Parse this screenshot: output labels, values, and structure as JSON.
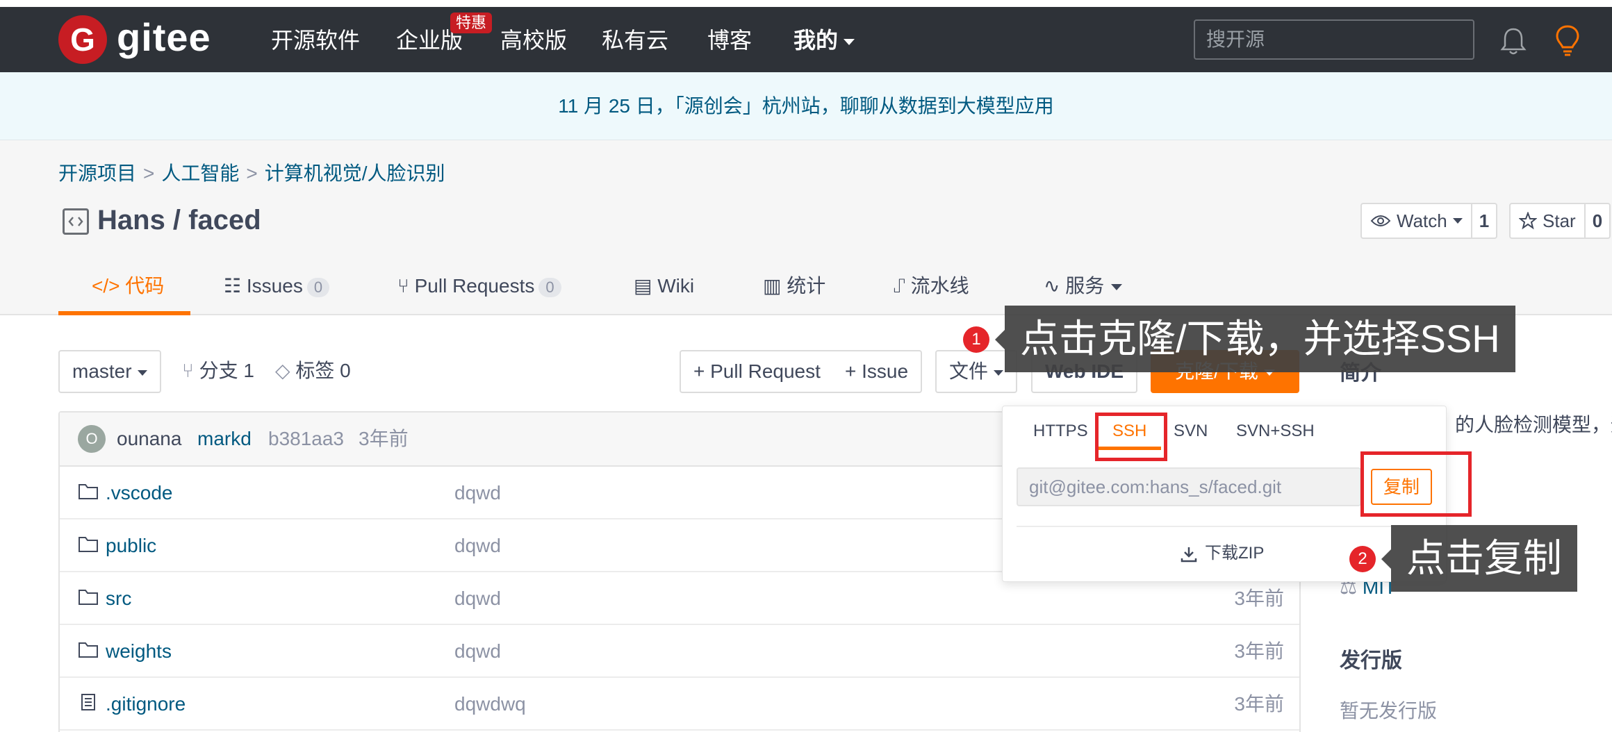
{
  "nav": {
    "logo_letter": "G",
    "logo_text": "gitee",
    "items": [
      "开源软件",
      "企业版",
      "高校版",
      "私有云",
      "博客",
      "我的"
    ],
    "badge": "特惠",
    "search_placeholder": "搜开源"
  },
  "announcement": "11 月 25 日，「源创会」杭州站，聊聊从数据到大模型应用",
  "breadcrumb": [
    "开源项目",
    "人工智能",
    "计算机视觉/人脸识别"
  ],
  "repo": {
    "title": "Hans / faced",
    "watch_label": "Watch",
    "watch_count": "1",
    "star_label": "Star",
    "star_count": "0"
  },
  "tabs": [
    {
      "label": "代码",
      "count": ""
    },
    {
      "label": "Issues",
      "count": "0"
    },
    {
      "label": "Pull Requests",
      "count": "0"
    },
    {
      "label": "Wiki",
      "count": ""
    },
    {
      "label": "统计",
      "count": ""
    },
    {
      "label": "流水线",
      "count": ""
    },
    {
      "label": "服务",
      "count": ""
    }
  ],
  "toolbar": {
    "branch": "master",
    "branches": "分支 1",
    "tags": "标签 0",
    "pull_request": "+ Pull Request",
    "issue": "+ Issue",
    "file": "文件",
    "web_ide": "Web IDE",
    "clone": "克隆/下载"
  },
  "commit": {
    "avatar_letter": "O",
    "author": "ounana",
    "message": "markd",
    "hash": "b381aa3",
    "time": "3年前"
  },
  "files": [
    {
      "name": ".vscode",
      "msg": "dqwd",
      "time": "",
      "type": "folder"
    },
    {
      "name": "public",
      "msg": "dqwd",
      "time": "",
      "type": "folder"
    },
    {
      "name": "src",
      "msg": "dqwd",
      "time": "3年前",
      "type": "folder"
    },
    {
      "name": "weights",
      "msg": "dqwd",
      "time": "3年前",
      "type": "folder"
    },
    {
      "name": ".gitignore",
      "msg": "dqwdwq",
      "time": "3年前",
      "type": "file"
    }
  ],
  "sidebar": {
    "intro_title": "简介",
    "intro_text": "的人脸检测模型，通",
    "license": "MIT",
    "release_title": "发行版",
    "release_text": "暂无发行版"
  },
  "clone_panel": {
    "protocols": [
      "HTTPS",
      "SSH",
      "SVN",
      "SVN+SSH"
    ],
    "url": "git@gitee.com:hans_s/faced.git",
    "copy": "复制",
    "download_zip": "下载ZIP"
  },
  "annotations": {
    "step1_num": "1",
    "step1_text": "点击克隆/下载，并选择SSH",
    "step2_num": "2",
    "step2_text": "点击复制"
  },
  "colors": {
    "nav_bg": "#2e3238",
    "brand_red": "#c71d23",
    "accent_orange": "#fe7300",
    "link_blue": "#005980",
    "annotation_red": "#e5252a"
  }
}
